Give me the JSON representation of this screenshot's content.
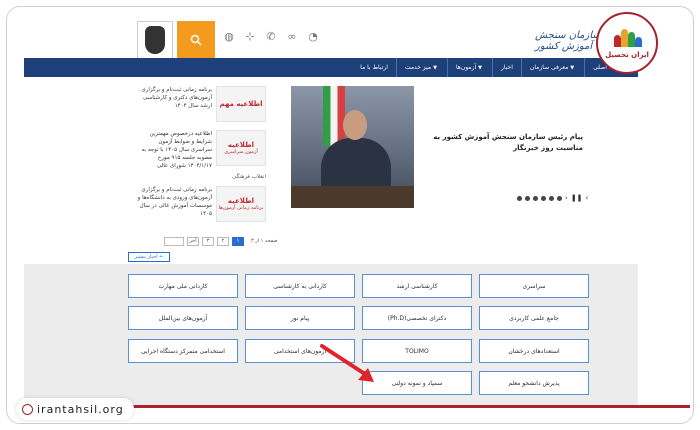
{
  "nav": {
    "items": [
      {
        "label": "صفحه اصلی",
        "caret": false
      },
      {
        "label": "معرفی سازمان",
        "caret": true
      },
      {
        "label": "اخبار",
        "caret": false
      },
      {
        "label": "آزمون‌ها",
        "caret": true
      },
      {
        "label": "میز خدمت",
        "caret": true
      },
      {
        "label": "ارتباط با ما",
        "caret": false
      }
    ]
  },
  "header": {
    "wordmark": "سازمان سنجش آموزش کشور",
    "search_icon": "search-icon"
  },
  "slider": {
    "caption": "پیام رئیس سازمان سنجش آموزش کشور به مناسبت روز خبرنگار",
    "pause": "❚❚",
    "prev": "‹",
    "next": "›"
  },
  "news": [
    {
      "text": "برنامه زمانی ثبت‌نام و برگزاری آزمون‌های دکتری و کارشناسی ارشد سال ۱۴۰۴",
      "thumb_title": "اطلاعیه مهم",
      "thumb_sub": ""
    },
    {
      "text": "اطلاعیه درخصوص مهمترین شرایط و ضوابط آزمون سراسری سال ۱۴۰۵ با توجه به مصوبه جلسه ۹۱۵ مورخ ۱۴۰۴/۱/۱۷ شورای عالی",
      "thumb_title": "اطلاعیه",
      "thumb_sub": "آزمون سراسری",
      "meta": "انقلاب فرهنگی"
    },
    {
      "text": "برنامه زمانی ثبت‌نام و برگزاری آزمون‌های ورودی به دانشگاه‌ها و موسسات آموزش عالی در سال ۱۴۰۵",
      "thumb_title": "اطلاعیه",
      "thumb_sub": "برنامه زمانی آزمون‌ها"
    }
  ],
  "pager": {
    "info": "صفحه ۱ از ۳",
    "pages": [
      "۱",
      "۲",
      "۳"
    ],
    "last": "آخر"
  },
  "more_button": "اخبار بیشتر ←",
  "quick_links": [
    [
      "سراسری",
      "کارشناسی ارشد",
      "کاردانی به کارشناسی",
      "کاردانی ملی مهارت"
    ],
    [
      "جامع علمی کاربردی",
      "دکترای تخصصی(Ph.D)",
      "پیام نور",
      "آزمون‌های بین‌الملل"
    ],
    [
      "استعدادهای درخشان",
      "TOLIMO",
      "آزمون‌های استخدامی",
      "استخدامی متمرکز دستگاه اجرایی"
    ],
    [
      "پذیرش دانشجو معلم",
      "سمپاد و نمونه دولتی"
    ]
  ],
  "badge": {
    "label": "ایران تحصیل"
  },
  "url": "irantahsil.org",
  "colors": {
    "nav": "#1d3f7a",
    "accent": "#f39a1f",
    "link_border": "#5a8fd6",
    "brand_red": "#a3232c"
  }
}
